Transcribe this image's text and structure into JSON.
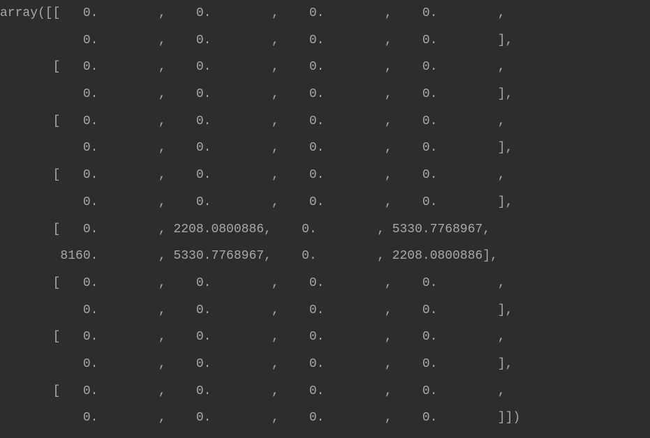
{
  "output": {
    "prefix": "array(",
    "suffix": ")",
    "rows": [
      [
        "   0.        ",
        "   0.        ",
        "   0.        ",
        "   0.        ",
        "   0.        ",
        "   0.        ",
        "   0.        ",
        "   0.        "
      ],
      [
        "   0.        ",
        "   0.        ",
        "   0.        ",
        "   0.        ",
        "   0.        ",
        "   0.        ",
        "   0.        ",
        "   0.        "
      ],
      [
        "   0.        ",
        "   0.        ",
        "   0.        ",
        "   0.        ",
        "   0.        ",
        "   0.        ",
        "   0.        ",
        "   0.        "
      ],
      [
        "   0.        ",
        "   0.        ",
        "   0.        ",
        "   0.        ",
        "   0.        ",
        "   0.        ",
        "   0.        ",
        "   0.        "
      ],
      [
        "   0.        ",
        "2208.0800886",
        "   0.        ",
        "5330.7768967",
        "8160.        ",
        "5330.7768967",
        "   0.        ",
        "2208.0800886"
      ],
      [
        "   0.        ",
        "   0.        ",
        "   0.        ",
        "   0.        ",
        "   0.        ",
        "   0.        ",
        "   0.        ",
        "   0.        "
      ],
      [
        "   0.        ",
        "   0.        ",
        "   0.        ",
        "   0.        ",
        "   0.        ",
        "   0.        ",
        "   0.        ",
        "   0.        "
      ],
      [
        "   0.        ",
        "   0.        ",
        "   0.        ",
        "   0.        ",
        "   0.        ",
        "   0.        ",
        "   0.        ",
        "   0.        "
      ]
    ]
  }
}
